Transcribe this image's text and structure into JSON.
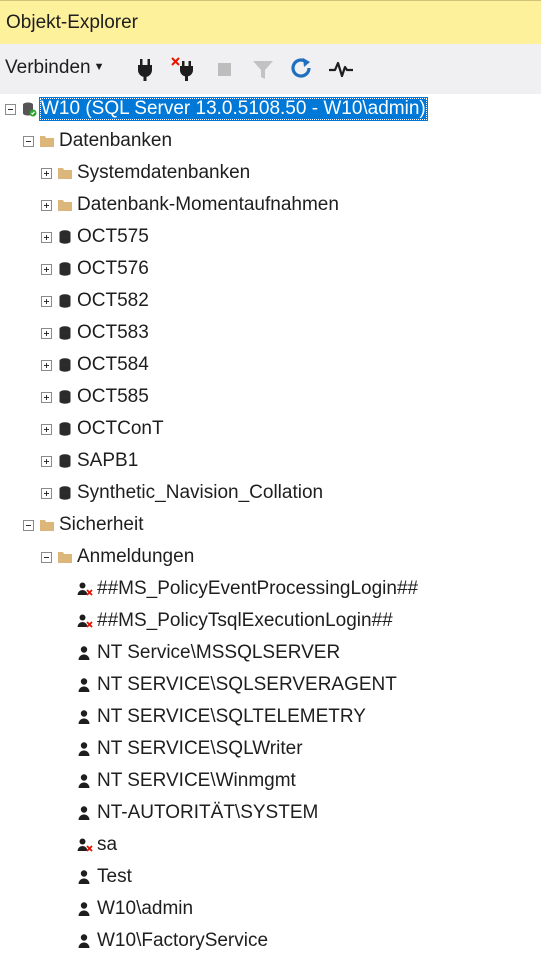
{
  "window": {
    "title": "Objekt-Explorer"
  },
  "toolbar": {
    "connect_label": "Verbinden",
    "icons": [
      "connect-plug-icon",
      "disconnect-plug-icon",
      "stop-icon",
      "filter-icon",
      "refresh-icon",
      "activity-monitor-icon"
    ]
  },
  "tree": {
    "server": {
      "label": "W10 (SQL Server 13.0.5108.50 - W10\\admin)"
    },
    "databases": {
      "label": "Datenbanken",
      "folders": [
        {
          "label": "Systemdatenbanken"
        },
        {
          "label": "Datenbank-Momentaufnahmen"
        }
      ],
      "items": [
        {
          "label": "OCT575"
        },
        {
          "label": "OCT576"
        },
        {
          "label": "OCT582"
        },
        {
          "label": "OCT583"
        },
        {
          "label": "OCT584"
        },
        {
          "label": "OCT585"
        },
        {
          "label": "OCTConT"
        },
        {
          "label": "SAPB1"
        },
        {
          "label": "Synthetic_Navision_Collation"
        }
      ]
    },
    "security": {
      "label": "Sicherheit",
      "logins": {
        "label": "Anmeldungen",
        "items": [
          {
            "label": "##MS_PolicyEventProcessingLogin##",
            "disabled": true
          },
          {
            "label": "##MS_PolicyTsqlExecutionLogin##",
            "disabled": true
          },
          {
            "label": "NT Service\\MSSQLSERVER",
            "disabled": false
          },
          {
            "label": "NT SERVICE\\SQLSERVERAGENT",
            "disabled": false
          },
          {
            "label": "NT SERVICE\\SQLTELEMETRY",
            "disabled": false
          },
          {
            "label": "NT SERVICE\\SQLWriter",
            "disabled": false
          },
          {
            "label": "NT SERVICE\\Winmgmt",
            "disabled": false
          },
          {
            "label": "NT-AUTORITÄT\\SYSTEM",
            "disabled": false
          },
          {
            "label": "sa",
            "disabled": true
          },
          {
            "label": "Test",
            "disabled": false
          },
          {
            "label": "W10\\admin",
            "disabled": false
          },
          {
            "label": "W10\\FactoryService",
            "disabled": false
          }
        ]
      }
    }
  },
  "colors": {
    "title_bar": "#fdf19b",
    "toolbar": "#f0f0f2",
    "selection": "#0078d7",
    "folder": "#dcb67a",
    "refresh": "#1e6fbf",
    "disabled_mark": "#e51400"
  }
}
